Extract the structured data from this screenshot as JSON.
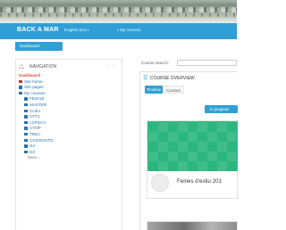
{
  "header": {
    "brand": "BACK A MAR",
    "language": "English (en)",
    "my_courses": "My courses",
    "caret": "▾"
  },
  "dashboard_button": "Dashboard",
  "navigation": {
    "title": "NAVIGATION",
    "controls": "▫ ▫",
    "items": [
      {
        "label": "Dashboard",
        "level": 1,
        "active": true,
        "icon": "home-icon"
      },
      {
        "label": "Site home",
        "level": 1,
        "icon": "home-icon"
      },
      {
        "label": "Site pages",
        "level": 1,
        "icon": "folder-icon"
      },
      {
        "label": "My courses",
        "level": 1,
        "icon": "folder-icon"
      },
      {
        "label": "FE2018",
        "level": 2,
        "icon": "folder-icon"
      },
      {
        "label": "MASTER",
        "level": 2,
        "icon": "folder-icon"
      },
      {
        "label": "CUE1",
        "level": 2,
        "icon": "folder-icon"
      },
      {
        "label": "CFT1",
        "level": 2,
        "icon": "folder-icon"
      },
      {
        "label": "LCPSCV",
        "level": 2,
        "icon": "folder-icon"
      },
      {
        "label": "CTOP",
        "level": 2,
        "icon": "folder-icon"
      },
      {
        "label": "TREC",
        "level": 2,
        "icon": "folder-icon"
      },
      {
        "label": "CGORCNTD",
        "level": 2,
        "icon": "folder-icon"
      },
      {
        "label": "D4",
        "level": 2,
        "icon": "folder-icon"
      },
      {
        "label": "D3",
        "level": 2,
        "icon": "folder-icon"
      }
    ],
    "more": "More..."
  },
  "course_search": {
    "label": "Course search:"
  },
  "overview": {
    "title": "COURSE OVERVIEW",
    "tabs": [
      "Timeline",
      "Courses"
    ],
    "in_progress": "In progress",
    "course_title": "Feines d'estiu 201",
    "accent": "#2ea0d6",
    "card_color": "#2bb57f"
  }
}
